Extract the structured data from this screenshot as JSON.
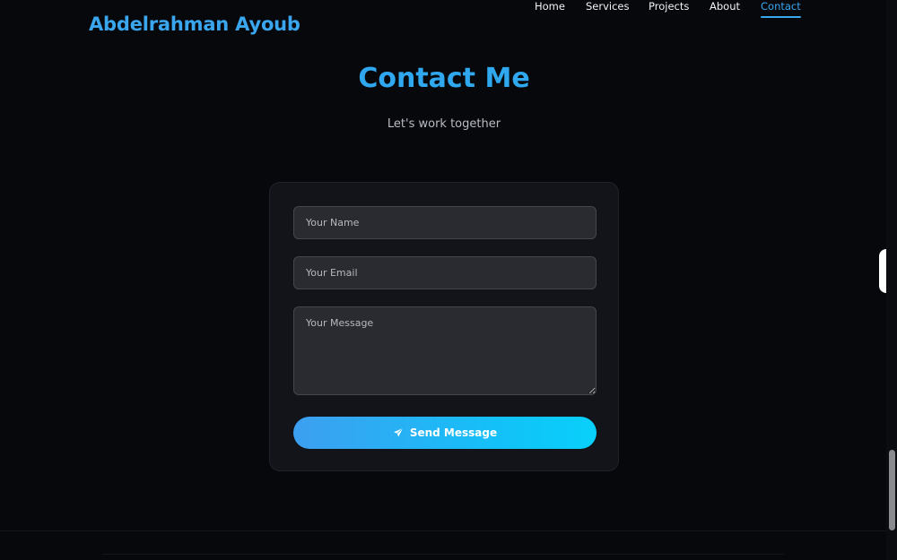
{
  "header": {
    "brand": "Abdelrahman Ayoub",
    "nav": [
      {
        "label": "Home",
        "active": false
      },
      {
        "label": "Services",
        "active": false
      },
      {
        "label": "Projects",
        "active": false
      },
      {
        "label": "About",
        "active": false
      },
      {
        "label": "Contact",
        "active": true
      }
    ]
  },
  "contact": {
    "title": "Contact Me",
    "subtitle": "Let's work together",
    "name_placeholder": "Your Name",
    "email_placeholder": "Your Email",
    "message_placeholder": "Your Message",
    "submit_label": "Send Message",
    "submit_icon": "paper-plane-icon"
  },
  "colors": {
    "accent": "#3aa6ee",
    "background": "#07080c",
    "card": "#121419",
    "field": "#2a2b30",
    "button_gradient_start": "#3d9ff0",
    "button_gradient_end": "#08d0fb"
  }
}
